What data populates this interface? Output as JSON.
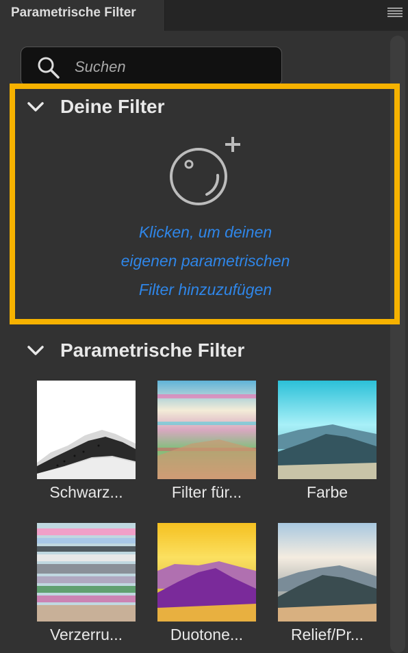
{
  "tab": {
    "title": "Parametrische Filter",
    "menu_icon": "hamburger-menu-icon"
  },
  "search": {
    "placeholder": "Suchen",
    "icon": "search-icon"
  },
  "your_filters": {
    "title": "Deine Filter",
    "add_icon": "add-filter-icon",
    "add_text_lines": [
      "Klicken, um deinen",
      "eigenen parametrischen",
      "Filter hinzuzufügen"
    ]
  },
  "parametric_filters": {
    "title": "Parametrische Filter",
    "items": [
      {
        "label": "Schwarz..."
      },
      {
        "label": "Filter für..."
      },
      {
        "label": "Farbe"
      },
      {
        "label": "Verzerru..."
      },
      {
        "label": "Duotone..."
      },
      {
        "label": "Relief/Pr..."
      }
    ]
  },
  "colors": {
    "highlight": "#f6b200",
    "link": "#2f86e8",
    "panel": "#323232"
  }
}
